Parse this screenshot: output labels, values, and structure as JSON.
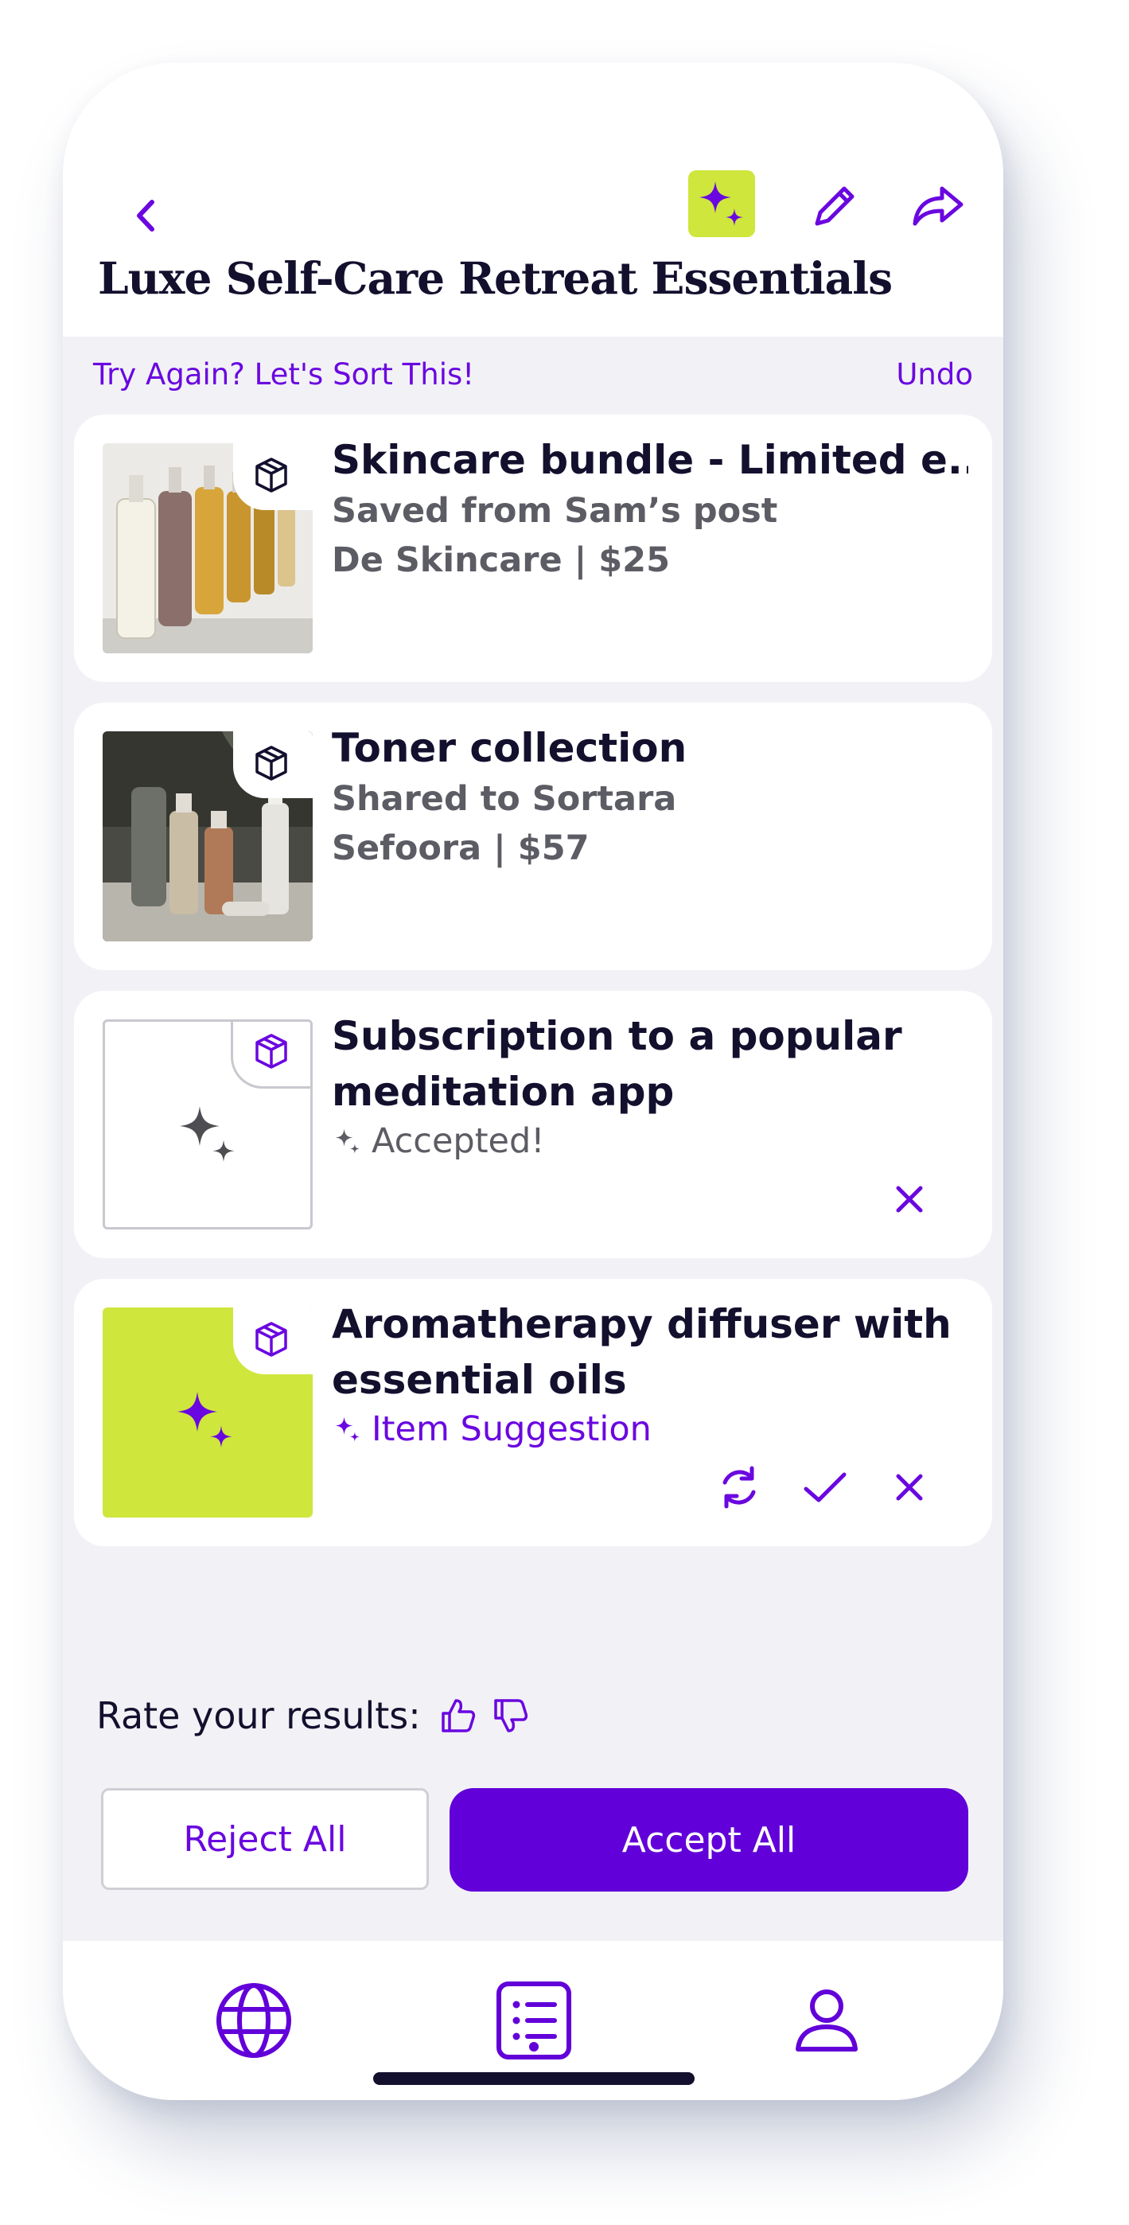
{
  "header": {
    "title": "Luxe Self-Care Retreat Essentials",
    "back_icon": "chevron-left-icon",
    "ai_icon": "sparkles-icon",
    "edit_icon": "pencil-icon",
    "share_icon": "share-arrow-icon"
  },
  "sortbar": {
    "label": "Try Again? Let's Sort This!",
    "undo": "Undo"
  },
  "items": [
    {
      "title": "Skincare bundle - Limited e...",
      "line1": "Saved from Sam’s post",
      "line2": "De Skincare | $25",
      "type_icon": "box-icon"
    },
    {
      "title": "Toner collection",
      "line1": "Shared to Sortara",
      "line2": "Sefoora | $57",
      "type_icon": "box-icon"
    },
    {
      "title": "Subscription to a popular meditation app",
      "status": "Accepted!",
      "type_icon": "box-icon"
    },
    {
      "title": "Aromatherapy diffuser with essential oils",
      "status": "Item Suggestion",
      "type_icon": "box-icon"
    }
  ],
  "footer": {
    "rate_label": "Rate your results:",
    "reject_all": "Reject All",
    "accept_all": "Accept All"
  },
  "tabs": [
    "globe-icon",
    "list-icon",
    "user-icon"
  ],
  "colors": {
    "accent": "#6200d9",
    "lime": "#cfe63d",
    "ink": "#13102e",
    "muted": "#5c5c64",
    "background": "#f2f2f6"
  }
}
